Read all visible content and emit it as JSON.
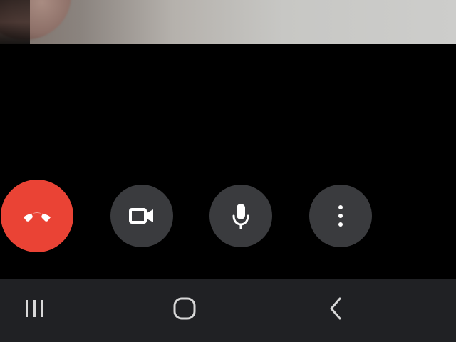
{
  "video_preview": {
    "visible": true
  },
  "call_controls": {
    "end_call": {
      "icon": "phone-hangup-icon",
      "background": "#ea4335"
    },
    "video": {
      "icon": "video-camera-icon",
      "background": "#3a3b3e"
    },
    "microphone": {
      "icon": "microphone-icon",
      "background": "#3a3b3e"
    },
    "more": {
      "icon": "more-vertical-icon",
      "background": "#3a3b3e"
    }
  },
  "navigation_bar": {
    "recent_apps": {
      "icon": "recent-apps-icon"
    },
    "home": {
      "icon": "home-icon"
    },
    "back": {
      "icon": "back-icon"
    },
    "background": "#202124"
  }
}
